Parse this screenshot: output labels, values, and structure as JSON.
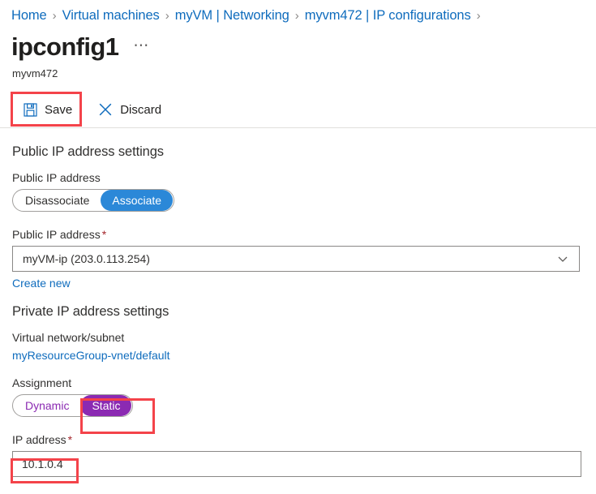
{
  "breadcrumb": {
    "separator": "›",
    "items": [
      {
        "label": "Home"
      },
      {
        "label": "Virtual machines"
      },
      {
        "label": "myVM | Networking"
      },
      {
        "label": "myvm472 | IP configurations"
      }
    ]
  },
  "header": {
    "title": "ipconfig1",
    "ellipsis": "⋯",
    "subtitle": "myvm472"
  },
  "toolbar": {
    "save_label": "Save",
    "save_icon": "save-floppy-icon",
    "discard_label": "Discard",
    "discard_icon": "close-x-icon"
  },
  "public_ip_section": {
    "heading": "Public IP address settings",
    "toggle_label": "Public IP address",
    "toggle_options": [
      {
        "label": "Disassociate",
        "selected": false
      },
      {
        "label": "Associate",
        "selected": true
      }
    ],
    "dropdown_label": "Public IP address",
    "required_marker": "*",
    "dropdown_value": "myVM-ip (203.0.113.254)",
    "dropdown_icon": "chevron-down-icon",
    "create_new_link": "Create new"
  },
  "private_ip_section": {
    "heading": "Private IP address settings",
    "vnet_label": "Virtual network/subnet",
    "vnet_value": "myResourceGroup-vnet/default",
    "assignment_label": "Assignment",
    "assignment_options": [
      {
        "label": "Dynamic",
        "selected": false
      },
      {
        "label": "Static",
        "selected": true
      }
    ],
    "ip_label": "IP address",
    "required_marker": "*",
    "ip_value": "10.1.0.4"
  },
  "annotations": {
    "save_highlight": "save-button-highlight",
    "static_highlight": "static-toggle-highlight",
    "ip_highlight": "ip-address-value-highlight"
  },
  "colors": {
    "link_blue": "#0f6cbd",
    "toggle_blue": "#2b88d8",
    "toggle_purple": "#8b2ab2",
    "annotation_red": "#f4434a",
    "required_red": "#a4262c"
  }
}
